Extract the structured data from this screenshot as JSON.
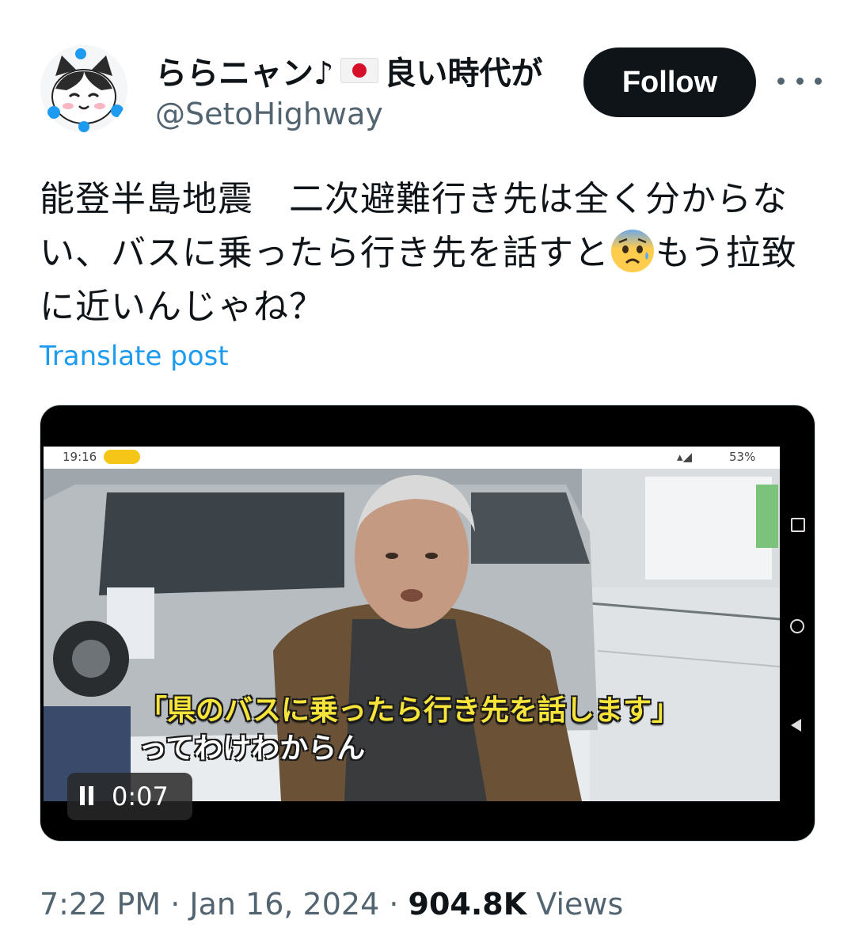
{
  "author": {
    "display_name": "ららニャン♪",
    "display_name_suffix": "良い時代が",
    "handle": "@SetoHighway"
  },
  "follow_label": "Follow",
  "tweet": {
    "text_part1": "能登半島地震　二次避難行き先は全く分からない、バスに乗ったら行き先を話すと",
    "text_part2": "もう拉致に近いんじゃね？",
    "emoji_name": "anxious-face-with-sweat-icon",
    "translate_label": "Translate post"
  },
  "video": {
    "status_time": "19:16",
    "battery": "53%",
    "subtitle_line1": "「県のバスに乗ったら行き先を話します」",
    "subtitle_line2": "ってわけわからん",
    "playback_time": "0:07"
  },
  "footer": {
    "time": "7:22 PM",
    "date": "Jan 16, 2024",
    "views_count": "904.8K",
    "views_label": "Views"
  },
  "colors": {
    "accent": "#1d9bf0",
    "follow_bg": "#0f1419",
    "secondary_text": "#536471",
    "subtitle_yellow": "#f7e43a"
  }
}
